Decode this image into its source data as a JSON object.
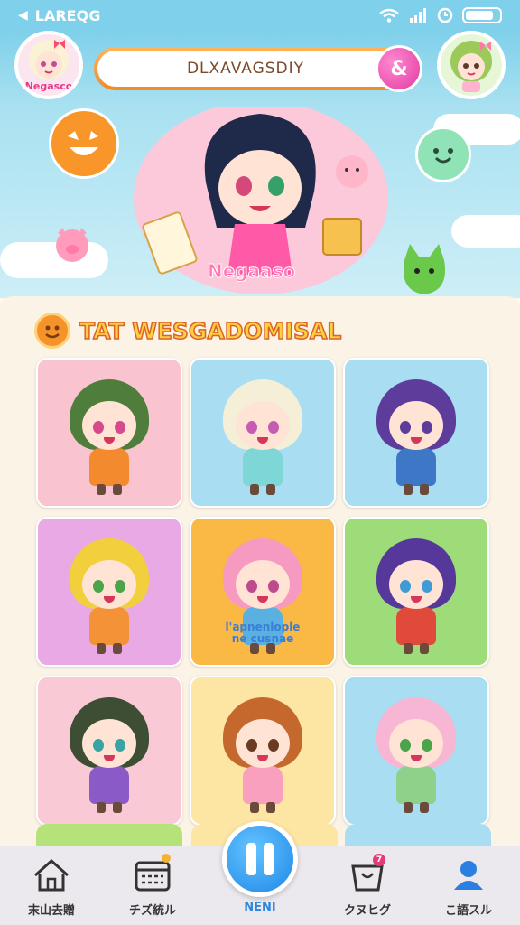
{
  "status_bar": {
    "back_icon": "back-arrow-icon",
    "carrier": "LAREQG ",
    "extra": "",
    "icons": [
      "wifi-icon",
      "signal-icon",
      "clock-icon",
      "battery-icon"
    ]
  },
  "header": {
    "left_avatar_label": "Negasco",
    "search_value": "DLXAVAGSDIY",
    "search_button_glyph": "&"
  },
  "hero": {
    "title": "Negaaso"
  },
  "section": {
    "title": "TAT WESGADOMISAL"
  },
  "cards": [
    {
      "bg": "#f9c3cf",
      "hair": "#4f7d3b",
      "eye": "#d64a8d",
      "body": "#f38a2e",
      "caption": ""
    },
    {
      "bg": "#a9ddf2",
      "hair": "#f4efd6",
      "eye": "#c65bb4",
      "body": "#7fd6d6",
      "caption": ""
    },
    {
      "bg": "#a9ddf2",
      "hair": "#5d3c9c",
      "eye": "#5d3c9c",
      "body": "#3e77c6",
      "caption": ""
    },
    {
      "bg": "#e8a9e4",
      "hair": "#f2cf3c",
      "eye": "#4aa44a",
      "body": "#f39237",
      "caption": ""
    },
    {
      "bg": "#f9b944",
      "hair": "#f79ac2",
      "eye": "#c04b8c",
      "body": "#5ab0e0",
      "caption": "l'apnenlople\nne cusnae"
    },
    {
      "bg": "#9ddc79",
      "hair": "#56389a",
      "eye": "#3e9bd6",
      "body": "#e04a3a",
      "caption": ""
    },
    {
      "bg": "#f9c9d6",
      "hair": "#3d4e35",
      "eye": "#3aa3a3",
      "body": "#8a5ac6",
      "caption": ""
    },
    {
      "bg": "#fde6a3",
      "hair": "#c4682e",
      "eye": "#6a3b22",
      "body": "#f8a0be",
      "caption": ""
    },
    {
      "bg": "#a9ddf2",
      "hair": "#f7b6d3",
      "eye": "#4aa44a",
      "body": "#8fd18a",
      "caption": ""
    }
  ],
  "nav": {
    "items": [
      {
        "label": "末山去贈",
        "icon": "home-icon"
      },
      {
        "label": "チズ統ル",
        "icon": "calendar-icon",
        "badge": ""
      },
      {
        "label": "クヌヒグ",
        "icon": "shop-icon",
        "badge": "7"
      },
      {
        "label": "こ語スル",
        "icon": "profile-icon"
      }
    ],
    "center_label": "NENI",
    "center_icon": "pause-icon"
  }
}
